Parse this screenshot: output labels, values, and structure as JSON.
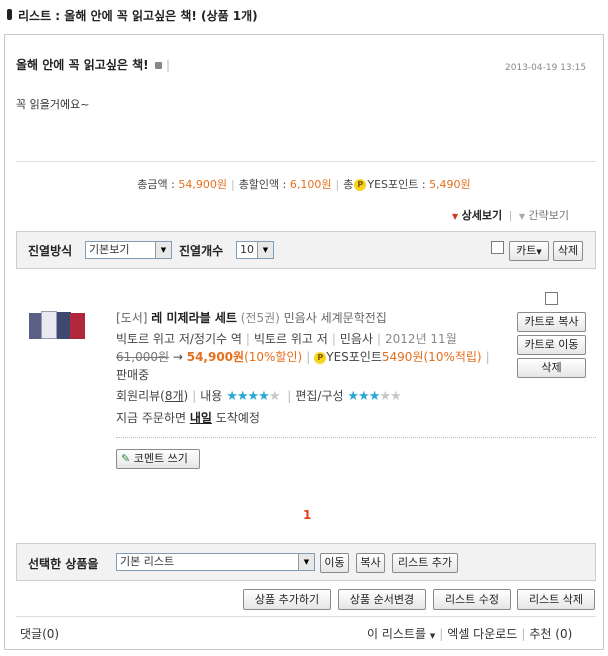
{
  "title_bar": {
    "prefix": "리스트 : ",
    "title": "올해 안에 꼭 읽고싶은 책!",
    "count": " (상품 1개)"
  },
  "list": {
    "name": "올해 안에 꼭 읽고싶은 책!",
    "date": "2013-04-19 13:15",
    "description": "꼭 읽을거에요~"
  },
  "totals": {
    "total_label": "총금액 : ",
    "total_value": "54,900원",
    "discount_label": "총할인액 : ",
    "discount_value": "6,100원",
    "points_prefix": "총",
    "points_badge": "P",
    "points_label": "YES포인트 : ",
    "points_value": "5,490원"
  },
  "view_toggle": {
    "detail": "상세보기",
    "simple": "간략보기"
  },
  "display_bar": {
    "mode_label": "진열방식",
    "mode_value": "기본보기",
    "count_label": "진열개수",
    "count_value": "10",
    "cart_button": "카트",
    "delete_button": "삭제"
  },
  "product": {
    "category": "[도서]",
    "title": "레 미제라블 세트",
    "volumes": "(전5권)",
    "series": "민음사 세계문학전집",
    "author": "빅토르 위고 저/정기수 역",
    "author2": "빅토르 위고 저",
    "publisher": "민음사",
    "pubdate": "2012년 11월",
    "original_price": "61,000원",
    "arrow": " → ",
    "sale_price": "54,900원",
    "discount": "(10%할인)",
    "points_badge": "P",
    "points_label": "YES포인트",
    "points_value": "5490원",
    "points_rate": "(10%적립)",
    "status": "판매중",
    "review_label": "회원리뷰(",
    "review_count": "8개",
    "review_close": ")",
    "content_label": "내용",
    "content_rating": 4,
    "edit_label": "편집/구성",
    "edit_rating": 3,
    "delivery_pre": "지금 주문하면 ",
    "delivery_day": "내일",
    "delivery_post": " 도착예정",
    "copy_to_cart": "카트로 복사",
    "move_to_cart": "카트로 이동",
    "delete": "삭제",
    "comment_button": "코멘트 쓰기"
  },
  "pagination": {
    "current": "1"
  },
  "bottom_bar": {
    "label": "선택한 상품을",
    "list_value": "기본 리스트",
    "move": "이동",
    "copy": "복사",
    "add_list": "리스트 추가"
  },
  "actions": {
    "add_product": "상품 추가하기",
    "reorder": "상품 순서변경",
    "edit_list": "리스트 수정",
    "delete_list": "리스트 삭제"
  },
  "footer": {
    "comments": "댓글(0)",
    "this_list": "이 리스트를",
    "excel": "엑셀 다운로드",
    "recommend": "추천 (0)"
  },
  "colors": {
    "accent": "#e4701e",
    "page_num": "#e1411c",
    "star": "#2aa7d3",
    "bar_bg": "#f2f2f2"
  }
}
